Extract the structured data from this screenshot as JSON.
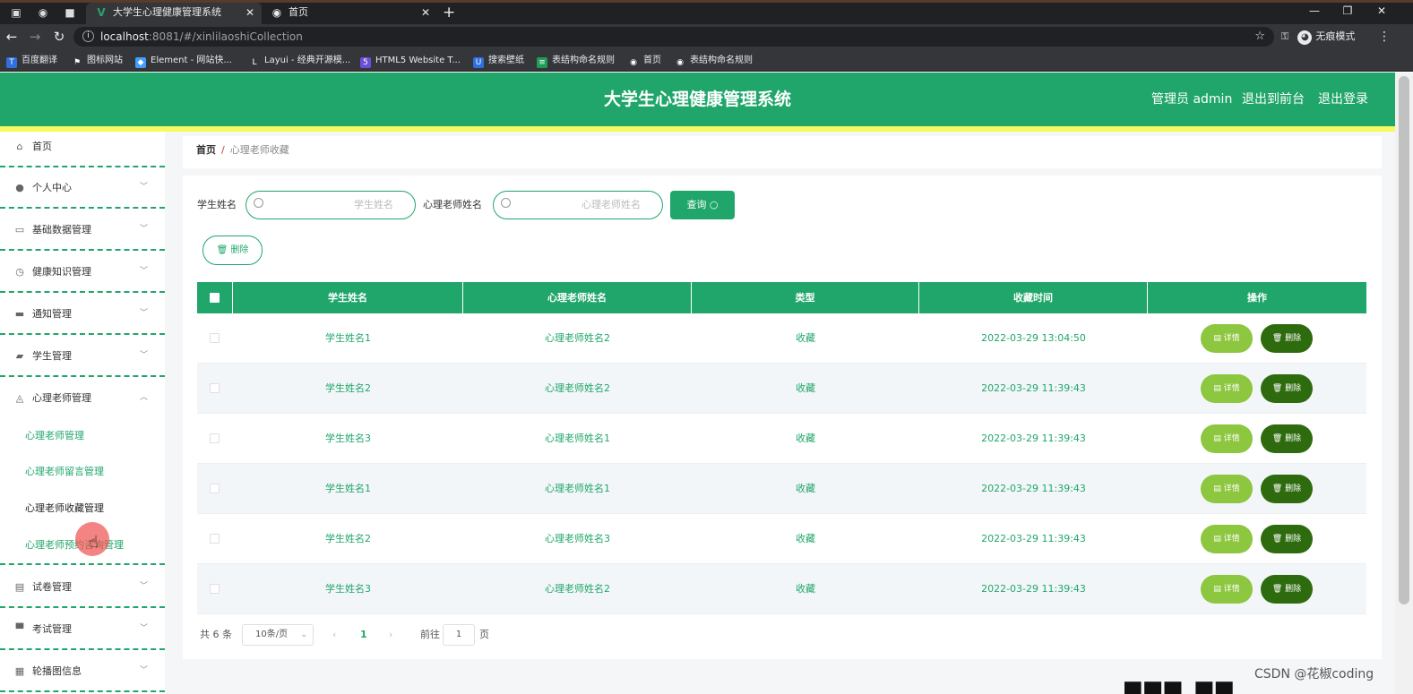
{
  "browser": {
    "tabs": [
      {
        "title": "大学生心理健康管理系统",
        "active": true
      },
      {
        "title": "首页",
        "active": false
      }
    ],
    "url_host": "localhost",
    "url_rest": ":8081/#/xinlilaoshiCollection",
    "incognito_label": "无痕模式",
    "bookmarks": [
      "百度翻译",
      "图标网站",
      "Element - 网站快...",
      "Layui - 经典开源模...",
      "HTML5 Website T...",
      "搜索壁纸",
      "表结构命名规则",
      "首页",
      "表结构命名规则"
    ]
  },
  "header": {
    "title": "大学生心理健康管理系统",
    "user": "管理员 admin",
    "frontend_link": "退出到前台",
    "logout_link": "退出登录"
  },
  "sidebar": {
    "items": [
      {
        "label": "首页",
        "icon": "home-icon",
        "glyph": "⌂"
      },
      {
        "label": "个人中心",
        "icon": "user-icon",
        "glyph": "●"
      },
      {
        "label": "基础数据管理",
        "icon": "chat-icon",
        "glyph": "▭"
      },
      {
        "label": "健康知识管理",
        "icon": "clock-icon",
        "glyph": "◷"
      },
      {
        "label": "通知管理",
        "icon": "briefcase-icon",
        "glyph": "▬"
      },
      {
        "label": "学生管理",
        "icon": "message-icon",
        "glyph": "▰"
      },
      {
        "label": "心理老师管理",
        "icon": "bell-icon",
        "glyph": "◬"
      },
      {
        "label": "试卷管理",
        "icon": "document-icon",
        "glyph": "▤"
      },
      {
        "label": "考试管理",
        "icon": "monitor-icon",
        "glyph": "▀"
      },
      {
        "label": "轮播图信息",
        "icon": "grid-icon",
        "glyph": "▦"
      }
    ],
    "subitems": [
      "心理老师管理",
      "心理老师留言管理",
      "心理老师收藏管理",
      "心理老师预约咨询管理"
    ]
  },
  "breadcrumb": {
    "home": "首页",
    "separator": "/",
    "current": "心理老师收藏"
  },
  "filters": {
    "student_label": "学生姓名",
    "student_placeholder": "学生姓名",
    "teacher_label": "心理老师姓名",
    "teacher_placeholder": "心理老师姓名",
    "query_button": "查询 ○",
    "delete_button": "🗑 删除"
  },
  "table": {
    "columns": [
      "学生姓名",
      "心理老师姓名",
      "类型",
      "收藏时间",
      "操作"
    ],
    "rows": [
      {
        "student": "学生姓名1",
        "teacher": "心理老师姓名2",
        "type": "收藏",
        "time": "2022-03-29 13:04:50"
      },
      {
        "student": "学生姓名2",
        "teacher": "心理老师姓名2",
        "type": "收藏",
        "time": "2022-03-29 11:39:43"
      },
      {
        "student": "学生姓名3",
        "teacher": "心理老师姓名1",
        "type": "收藏",
        "time": "2022-03-29 11:39:43"
      },
      {
        "student": "学生姓名1",
        "teacher": "心理老师姓名1",
        "type": "收藏",
        "time": "2022-03-29 11:39:43"
      },
      {
        "student": "学生姓名2",
        "teacher": "心理老师姓名3",
        "type": "收藏",
        "time": "2022-03-29 11:39:43"
      },
      {
        "student": "学生姓名3",
        "teacher": "心理老师姓名2",
        "type": "收藏",
        "time": "2022-03-29 11:39:43"
      }
    ],
    "detail_label": "▤ 详情",
    "delete_label": "🗑 删除"
  },
  "pagination": {
    "total": "共 6 条",
    "page_size": "10条/页",
    "current_page": "1",
    "goto_label": "前往",
    "goto_value": "1",
    "page_suffix": "页"
  },
  "watermark": "CSDN @花椒coding",
  "colors": {
    "primary": "#20a66a",
    "accent_bar": "#f7f95e",
    "detail_btn": "#8dc63f",
    "delete_btn": "#2e6b0f"
  }
}
